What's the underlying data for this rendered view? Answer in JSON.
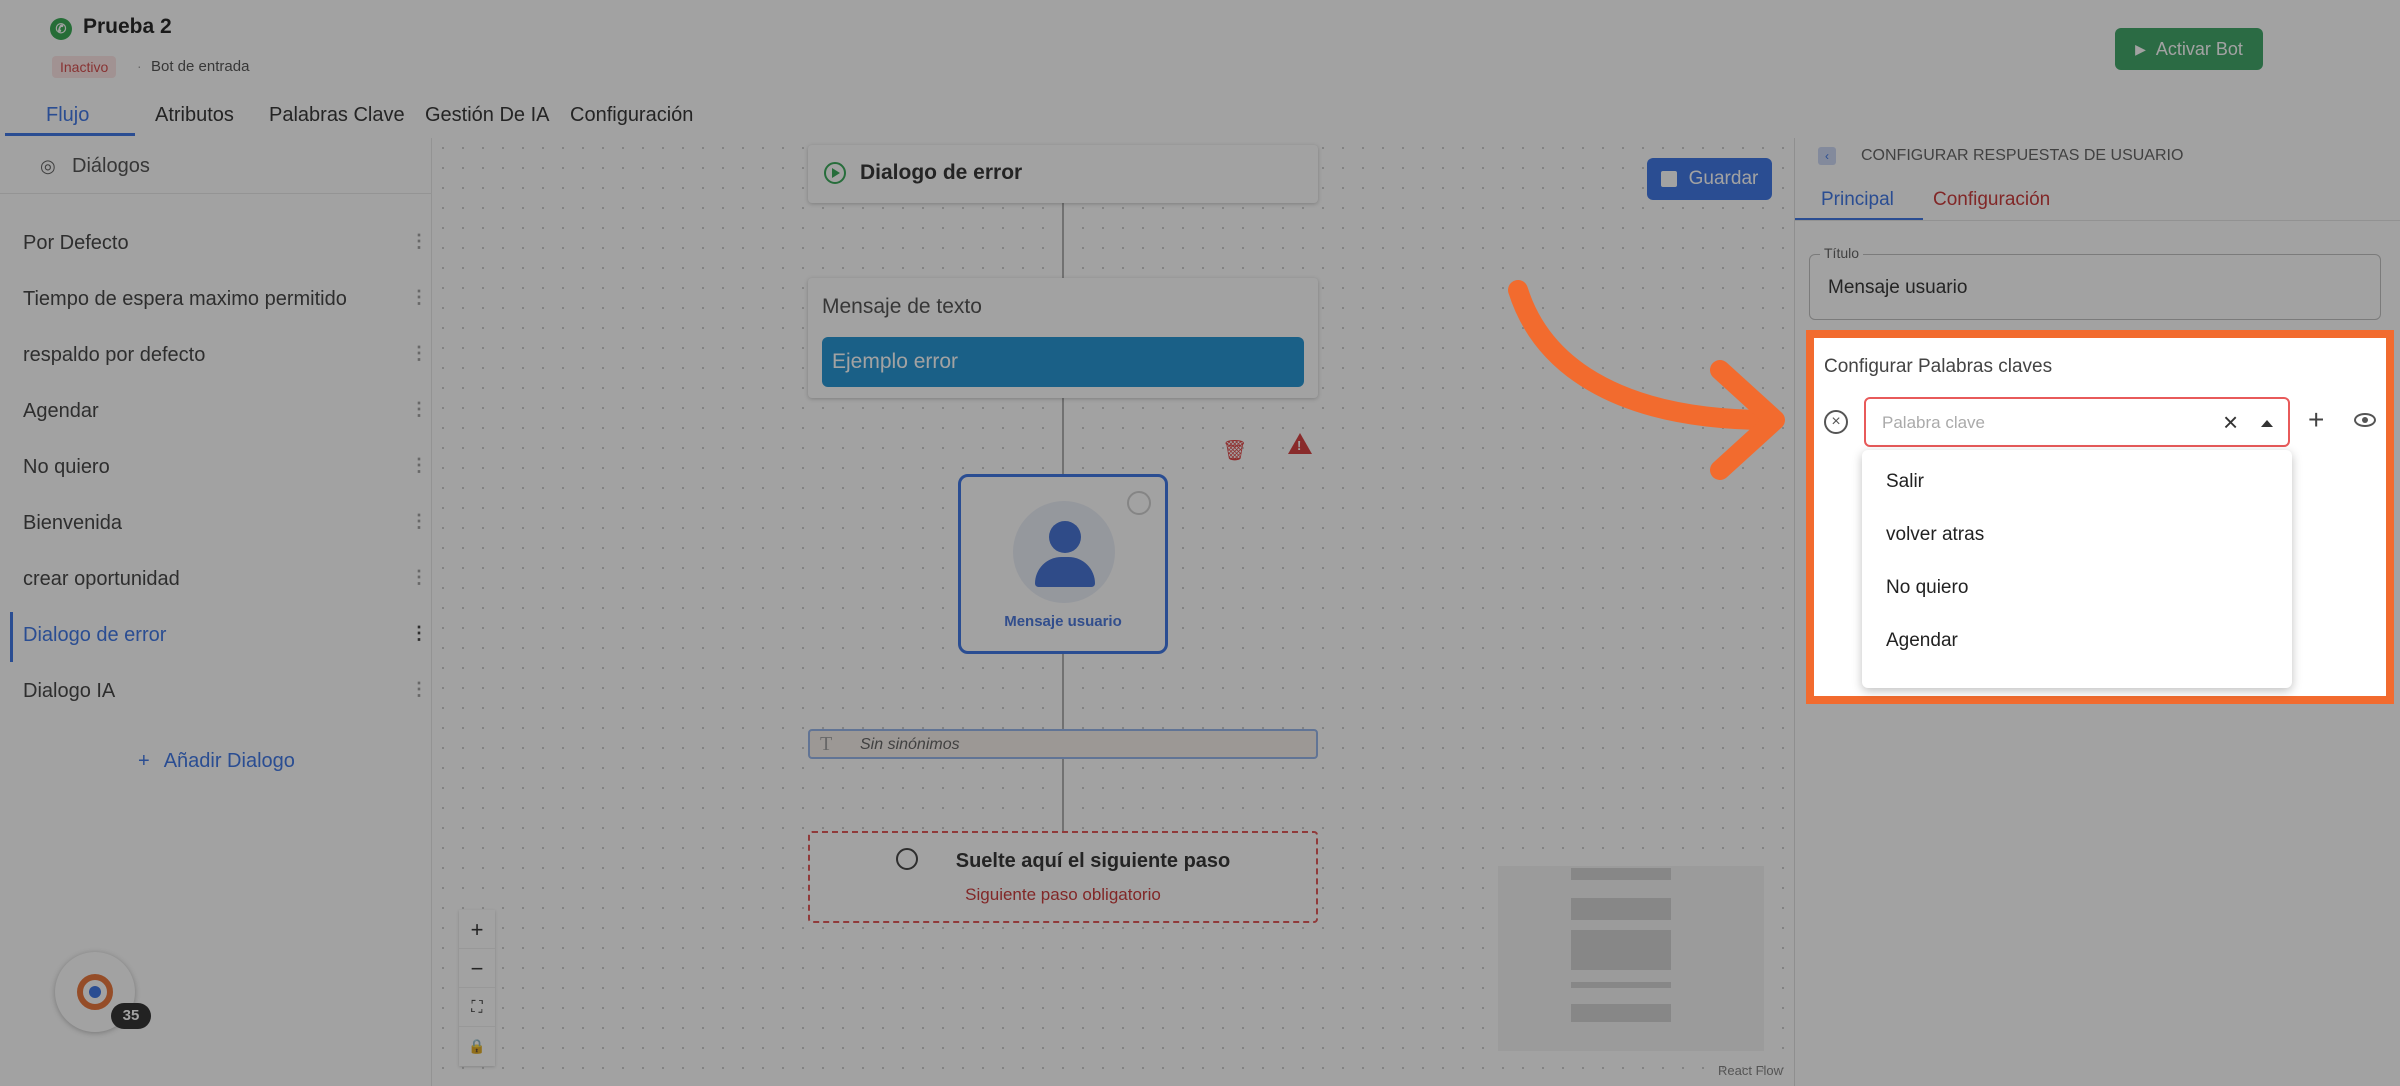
{
  "header": {
    "bot_name": "Prueba 2",
    "status_badge": "Inactivo",
    "separator": "·",
    "bot_type": "Bot de entrada",
    "activate_label": "Activar Bot"
  },
  "tabs": [
    "Flujo",
    "Atributos",
    "Palabras Clave",
    "Gestión De IA",
    "Configuración"
  ],
  "sidebar": {
    "title": "Diálogos",
    "items": [
      {
        "label": "Por Defecto"
      },
      {
        "label": "Tiempo de espera maximo permitido"
      },
      {
        "label": "respaldo por defecto"
      },
      {
        "label": "Agendar"
      },
      {
        "label": "No quiero"
      },
      {
        "label": "Bienvenida"
      },
      {
        "label": "crear oportunidad"
      },
      {
        "label": "Dialogo de error"
      },
      {
        "label": "Dialogo IA"
      }
    ],
    "selected_index": 7,
    "add_label": "Añadir Dialogo"
  },
  "canvas": {
    "save_label": "Guardar",
    "start_node_title": "Dialogo de error",
    "text_node_title": "Mensaje de texto",
    "text_node_bubble": "Ejemplo error",
    "user_node_label": "Mensaje usuario",
    "synonyms_label": "Sin sinónimos",
    "drop_title": "Suelte aquí el siguiente paso",
    "drop_sub": "Siguiente paso obligatorio",
    "zoom_in": "+",
    "zoom_out": "−",
    "fit": "⛶",
    "lock": "🔒",
    "attribution": "React Flow"
  },
  "chat_widget": {
    "count": "35"
  },
  "panel": {
    "title": "CONFIGURAR RESPUESTAS DE USUARIO",
    "tab_principal": "Principal",
    "tab_config": "Configuración",
    "field_label": "Título",
    "field_value": "Mensaje usuario",
    "keywords_title": "Configurar Palabras claves",
    "keyword_placeholder": "Palabra clave",
    "keyword_options": [
      "Salir",
      "volver atras",
      "No quiero",
      "Agendar"
    ]
  },
  "colors": {
    "accent": "#2d6ae3",
    "activate": "#2e9e5a",
    "highlight": "#f26b2e",
    "danger": "#c62828"
  }
}
